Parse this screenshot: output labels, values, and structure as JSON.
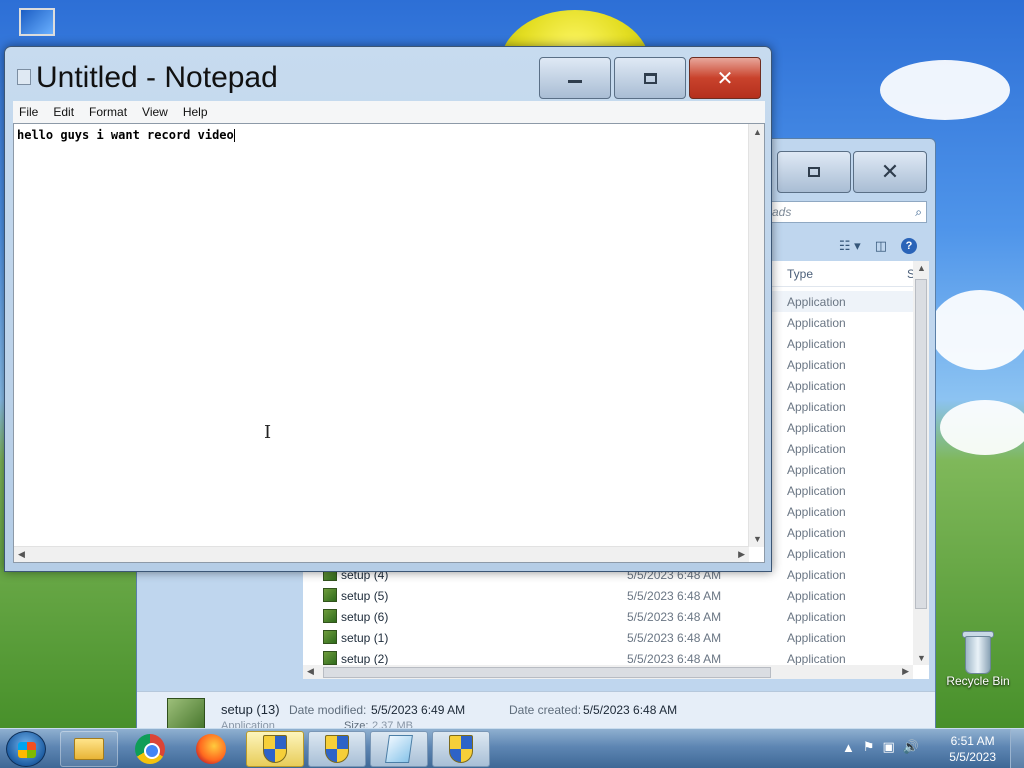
{
  "desktop": {
    "recycle_bin_label": "Recycle Bin"
  },
  "notepad": {
    "title": "Untitled - Notepad",
    "menu": [
      "File",
      "Edit",
      "Format",
      "View",
      "Help"
    ],
    "text": "hello guys i want record video",
    "caption_icons": [
      "minimize-icon",
      "maximize-icon",
      "close-icon"
    ]
  },
  "explorer": {
    "search_placeholder": "ads",
    "columns": {
      "type": "Type",
      "size": "S"
    },
    "hidden_rows_type": [
      "Application",
      "Application",
      "Application",
      "Application",
      "Application",
      "Application",
      "Application",
      "Application",
      "Application",
      "Application",
      "Application",
      "Application",
      "Application"
    ],
    "rows": [
      {
        "name": "setup (4)",
        "date": "5/5/2023 6:48 AM",
        "type": "Application"
      },
      {
        "name": "setup (5)",
        "date": "5/5/2023 6:48 AM",
        "type": "Application"
      },
      {
        "name": "setup (6)",
        "date": "5/5/2023 6:48 AM",
        "type": "Application"
      },
      {
        "name": "setup (1)",
        "date": "5/5/2023 6:48 AM",
        "type": "Application"
      },
      {
        "name": "setup (2)",
        "date": "5/5/2023 6:48 AM",
        "type": "Application"
      }
    ],
    "details": {
      "name": "setup (13)",
      "subtype": "Application",
      "date_modified_label": "Date modified:",
      "date_modified": "5/5/2023 6:49 AM",
      "date_created_label": "Date created:",
      "date_created": "5/5/2023 6:48 AM",
      "size_label": "Size:",
      "size": "2.37 MB"
    }
  },
  "taskbar": {
    "buttons": [
      "start-button",
      "explorer",
      "chrome",
      "firefox",
      "setup",
      "setup",
      "notepad",
      "setup"
    ],
    "clock_time": "6:51 AM",
    "clock_date": "5/5/2023"
  }
}
